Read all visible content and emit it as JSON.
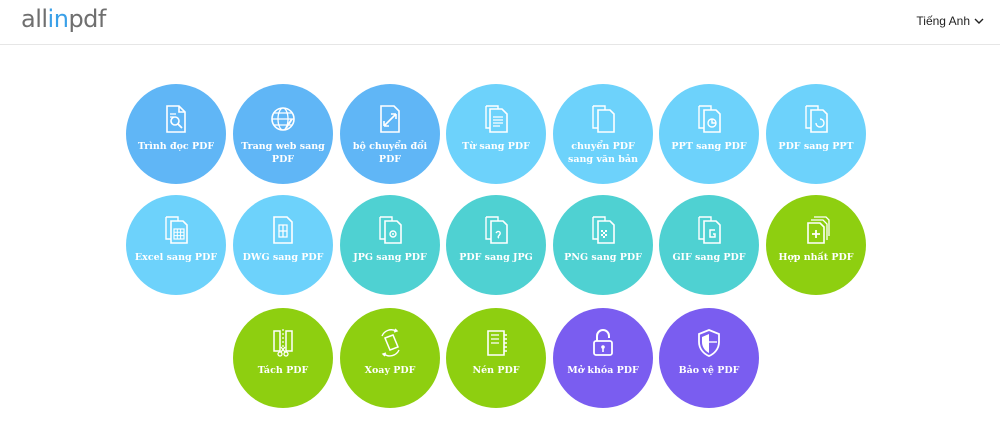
{
  "header": {
    "logo_prefix": "all",
    "logo_in": "in",
    "logo_suffix": "pdf",
    "language": "Tiếng Anh"
  },
  "tools": [
    {
      "label": "Trình đọc PDF",
      "icon": "pdf-reader-icon"
    },
    {
      "label": "Trang web sang PDF",
      "icon": "globe-icon"
    },
    {
      "label": "bộ chuyển đổi PDF",
      "icon": "convert-icon"
    },
    {
      "label": "Từ sang PDF",
      "icon": "word-doc-icon"
    },
    {
      "label": "chuyển PDF sang văn bản",
      "icon": "text-doc-icon"
    },
    {
      "label": "PPT sang PDF",
      "icon": "ppt-icon"
    },
    {
      "label": "PDF sang PPT",
      "icon": "pdf-ppt-icon"
    },
    {
      "label": "Excel sang PDF",
      "icon": "excel-icon"
    },
    {
      "label": "DWG sang PDF",
      "icon": "dwg-icon"
    },
    {
      "label": "JPG sang PDF",
      "icon": "jpg-icon"
    },
    {
      "label": "PDF sang JPG",
      "icon": "pdf-jpg-icon"
    },
    {
      "label": "PNG sang PDF",
      "icon": "png-icon"
    },
    {
      "label": "GIF sang PDF",
      "icon": "gif-icon"
    },
    {
      "label": "Hợp nhất PDF",
      "icon": "merge-icon"
    },
    {
      "label": "Tách PDF",
      "icon": "split-icon"
    },
    {
      "label": "Xoay PDF",
      "icon": "rotate-icon"
    },
    {
      "label": "Nén PDF",
      "icon": "compress-icon"
    },
    {
      "label": "Mở khóa PDF",
      "icon": "unlock-icon"
    },
    {
      "label": "Bảo vệ PDF",
      "icon": "shield-icon"
    }
  ],
  "colors": {
    "blue": "#60b6f6",
    "light_blue": "#6dd2fb",
    "teal": "#4fd1d2",
    "green": "#8ecf10",
    "purple": "#7a5df0"
  }
}
